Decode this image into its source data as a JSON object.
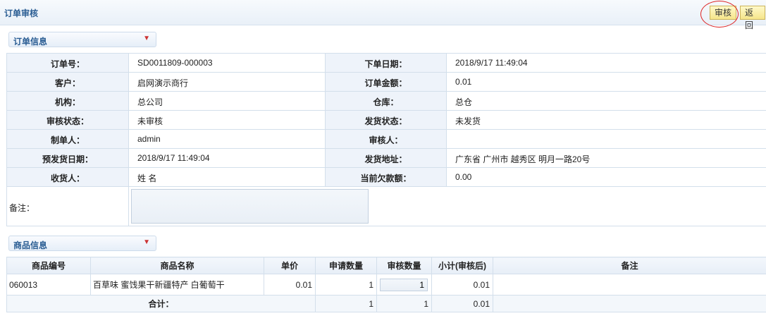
{
  "header": {
    "title": "订单审核",
    "approve_label": "审核",
    "back_label": "返回"
  },
  "order_section": {
    "title": "订单信息",
    "chevron": "chevron-down-icon"
  },
  "order": {
    "order_no_label": "订单号：",
    "order_no": "SD0011809-000003",
    "order_date_label": "下单日期：",
    "order_date": "2018/9/17 11:49:04",
    "customer_label": "客户：",
    "customer": "启网演示商行",
    "amount_label": "订单金额：",
    "amount": "0.01",
    "org_label": "机构：",
    "org": "总公司",
    "warehouse_label": "仓库：",
    "warehouse": "总仓",
    "audit_status_label": "审核状态：",
    "audit_status": "未审核",
    "ship_status_label": "发货状态：",
    "ship_status": "未发货",
    "creator_label": "制单人：",
    "creator": "admin",
    "auditor_label": "审核人：",
    "auditor": "",
    "plan_ship_label": "预发货日期：",
    "plan_ship": "2018/9/17 11:49:04",
    "ship_addr_label": "发货地址：",
    "ship_addr": "广东省 广州市 越秀区 明月一路20号",
    "receiver_label": "收货人：",
    "receiver": "姓 名",
    "debt_label": "当前欠款额：",
    "debt": "0.00",
    "remark_label": "备注：",
    "remark": ""
  },
  "goods_section": {
    "title": "商品信息",
    "chevron": "chevron-down-icon"
  },
  "goods": {
    "columns": [
      "商品编号",
      "商品名称",
      "单价",
      "申请数量",
      "审核数量",
      "小计(审核后)",
      "备注"
    ],
    "rows": [
      {
        "code": "060013",
        "name": "百草味 蜜饯果干新疆特产 白葡萄干",
        "price": "0.01",
        "req_qty": "1",
        "audit_qty": "1",
        "subtotal": "0.01",
        "remark": ""
      }
    ],
    "total": {
      "label": "合计：",
      "req_qty": "1",
      "audit_qty": "1",
      "subtotal": "0.01"
    }
  },
  "colors": {
    "accent": "#2a5d93",
    "button": "#f6e58a",
    "highlight_circle": "#dd2222"
  }
}
